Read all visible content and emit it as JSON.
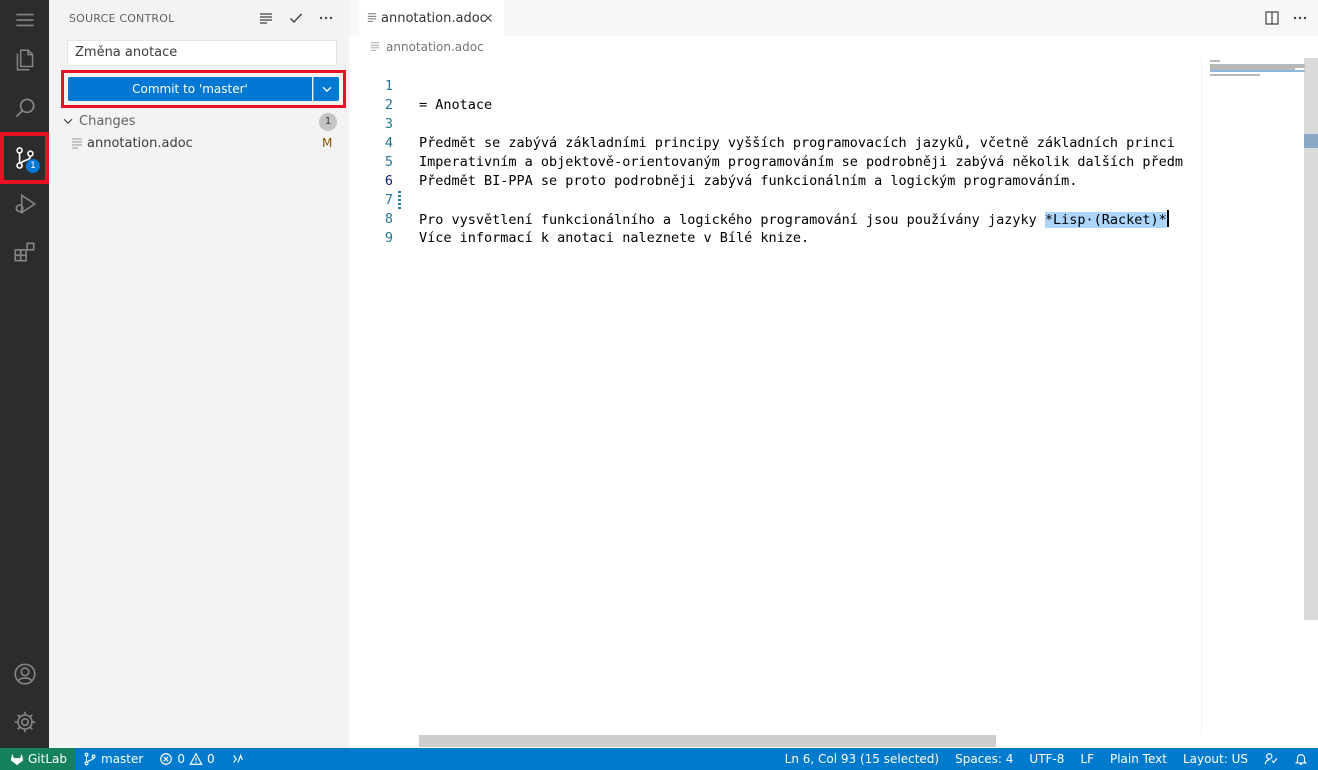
{
  "activity": {
    "source_control_badge": "1"
  },
  "sidebar": {
    "title": "SOURCE CONTROL",
    "commit_message": "Změna anotace",
    "commit_button": "Commit to 'master'",
    "changes_label": "Changes",
    "changes_count": "1",
    "files": [
      {
        "name": "annotation.adoc",
        "status": "M"
      }
    ]
  },
  "editor": {
    "tab_label": "annotation.adoc",
    "breadcrumb": "annotation.adoc",
    "lines": [
      {
        "num": "1",
        "text": "= Anotace"
      },
      {
        "num": "2",
        "text": ""
      },
      {
        "num": "3",
        "text": "Předmět se zabývá základními principy vyšších programovacích jazyků, včetně základních princi"
      },
      {
        "num": "4",
        "text": "Imperativním a objektově-orientovaným programováním se podrobněji zabývá několik dalších předm"
      },
      {
        "num": "5",
        "text": "Předmět BI-PPA se proto podrobněji zabývá funkcionálním a logickým programováním."
      },
      {
        "num": "6",
        "text_before": "Pro vysvětlení funkcionálního a logického programování jsou používány jazyky ",
        "selected": "*Lisp·(Racket)*"
      },
      {
        "num": "7",
        "text": ""
      },
      {
        "num": "8",
        "text": "Více informací k anotaci naleznete v Bílé knize."
      },
      {
        "num": "9",
        "text": ""
      }
    ]
  },
  "status": {
    "gitlab": "GitLab",
    "branch": "master",
    "errors": "0",
    "warnings": "0",
    "position": "Ln 6, Col 93 (15 selected)",
    "spaces": "Spaces: 4",
    "encoding": "UTF-8",
    "eol": "LF",
    "language": "Plain Text",
    "layout": "Layout: US"
  },
  "colors": {
    "accent": "#0078d4",
    "statusbar": "#007acc",
    "highlight_border": "#e81123",
    "selection": "#add6ff"
  }
}
